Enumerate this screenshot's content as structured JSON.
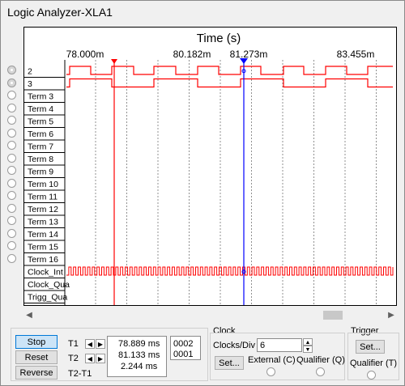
{
  "window": {
    "title": "Logic Analyzer-XLA1"
  },
  "plot": {
    "axis_title": "Time (s)",
    "time_labels": [
      "78.000m",
      "80.182m",
      "81.273m",
      "83.455m"
    ],
    "signals": [
      "2",
      "3",
      "Term 3",
      "Term 4",
      "Term 5",
      "Term 6",
      "Term 7",
      "Term 8",
      "Term 9",
      "Term 10",
      "Term 11",
      "Term 12",
      "Term 13",
      "Term 14",
      "Term 15",
      "Term 16",
      "Clock_Int",
      "Clock_Qua",
      "Trigg_Qua"
    ],
    "trace_color": "#ff0000",
    "cursor1_color": "#ff0000",
    "cursor2_color": "#0000ff"
  },
  "controls": {
    "stop": "Stop",
    "reset": "Reset",
    "reverse": "Reverse",
    "t1_label": "T1",
    "t2_label": "T2",
    "t2t1_label": "T2-T1",
    "t1_time": "78.889 ms",
    "t2_time": "81.133 ms",
    "delta_time": "2.244 ms",
    "t1_value": "0002",
    "t2_value": "0001"
  },
  "clock": {
    "heading": "Clock",
    "clocks_div_label": "Clocks/Div",
    "clocks_div_value": "6",
    "set_label": "Set...",
    "external_label": "External (C)",
    "qualifier_label": "Qualifier (Q)"
  },
  "trigger": {
    "heading": "Trigger",
    "set_label": "Set...",
    "qualifier_label": "Qualifier (T)"
  }
}
